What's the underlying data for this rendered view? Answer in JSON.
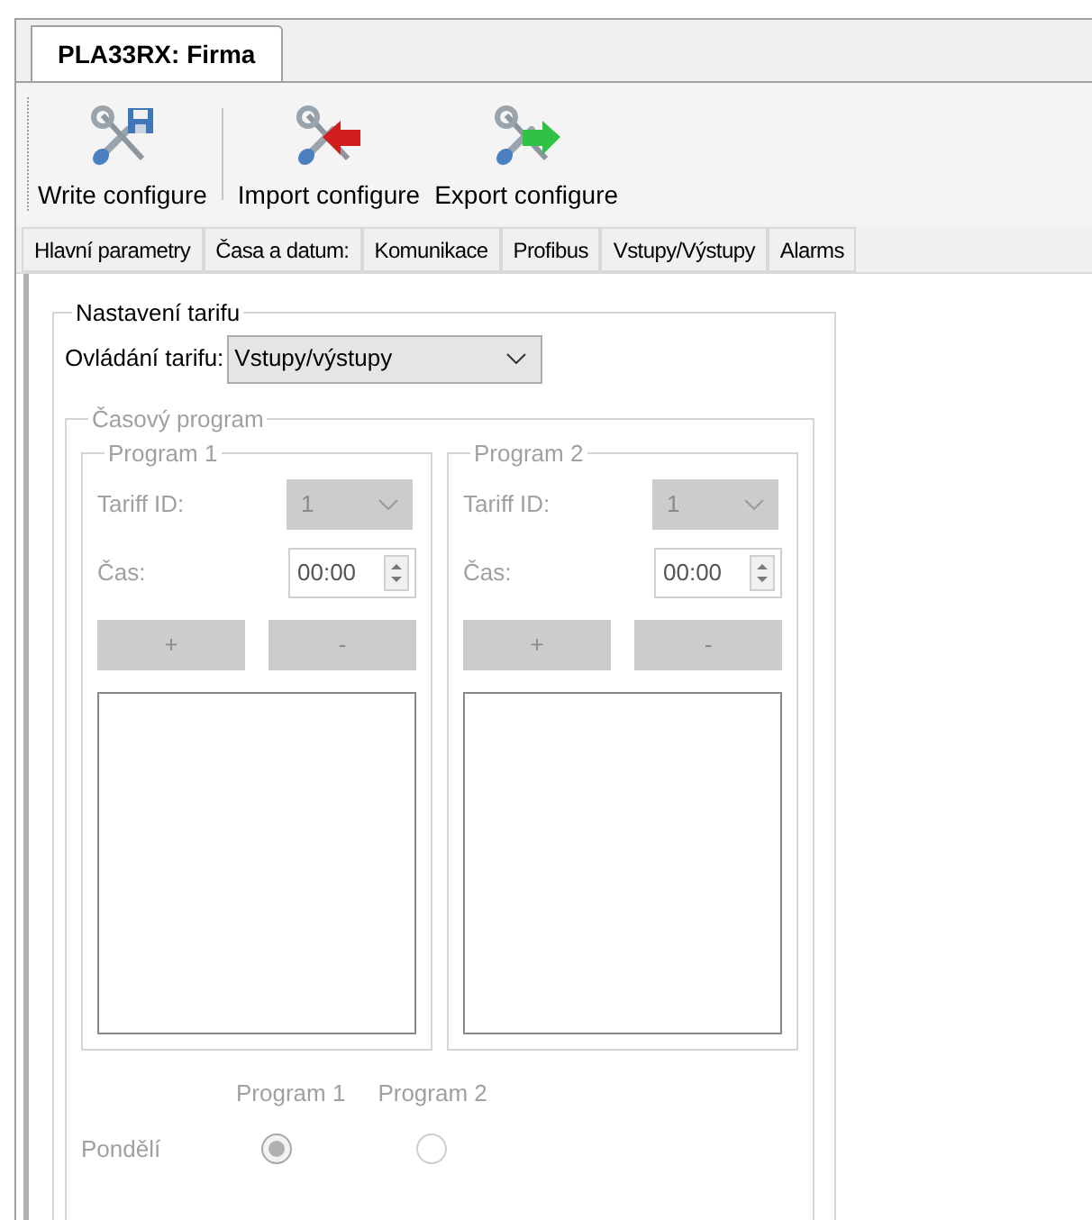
{
  "document_tab": {
    "label": "PLA33RX: Firma",
    "selected": true
  },
  "toolbar": [
    {
      "label": "Write configure",
      "kind": "write"
    },
    {
      "label": "Import configure",
      "kind": "import"
    },
    {
      "label": "Export configure",
      "kind": "export"
    }
  ],
  "tabs": [
    {
      "label": "Hlavní parametry"
    },
    {
      "label": "Časa a datum:"
    },
    {
      "label": "Komunikace"
    },
    {
      "label": "Profibus"
    },
    {
      "label": "Vstupy/Výstupy"
    },
    {
      "label": "Alarms"
    }
  ],
  "tariff_settings": {
    "title": "Nastavení tarifu",
    "control_label": "Ovládání tarifu:",
    "control_value": "Vstupy/výstupy",
    "schedule": {
      "title": "Časový program",
      "disabled": true,
      "programs": [
        {
          "title": "Program 1",
          "tariff_label": "Tariff ID:",
          "tariff_value": "1",
          "time_label": "Čas:",
          "time_value": "00:00",
          "add": "+",
          "remove": "-"
        },
        {
          "title": "Program 2",
          "tariff_label": "Tariff ID:",
          "tariff_value": "1",
          "time_label": "Čas:",
          "time_value": "00:00",
          "add": "+",
          "remove": "-"
        }
      ],
      "day_table": {
        "columns": [
          "Program 1",
          "Program 2"
        ],
        "rows": [
          {
            "day": "Pondělí",
            "choices": [
              {
                "selected": true
              },
              {
                "selected": false
              }
            ]
          }
        ]
      }
    }
  }
}
